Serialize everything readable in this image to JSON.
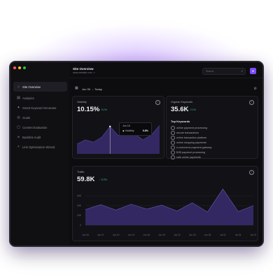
{
  "window": {
    "dot_colors": [
      "#ff5f57",
      "#febc2e",
      "#28c840"
    ]
  },
  "sidebar": {
    "items": [
      {
        "label": "Site Overview",
        "icon": "home-icon",
        "active": true
      },
      {
        "label": "Analytics",
        "icon": "analytics-icon",
        "active": false
      },
      {
        "label": "Smart Keyword Generator",
        "icon": "sparkle-icon",
        "active": false
      },
      {
        "label": "Goals",
        "icon": "target-icon",
        "active": false
      },
      {
        "label": "Content Evaluation",
        "icon": "document-icon",
        "active": false
      },
      {
        "label": "Backlink Audit",
        "icon": "link-icon",
        "active": false
      },
      {
        "label": "Link Optimization Wizard",
        "icon": "wand-icon",
        "active": false
      }
    ]
  },
  "header": {
    "title": "Site Overview",
    "url": "www.website.com",
    "search_placeholder": "Search",
    "avatar_icon": "user-icon"
  },
  "datebar": {
    "range": "Jun 30 → Today"
  },
  "visibility": {
    "label": "Visibility",
    "value": "10.15%",
    "delta": "↑ 5.1%",
    "tooltip_date": "Jun 16",
    "tooltip_label": "Visibility",
    "tooltip_value": "9.8%"
  },
  "organic_keywords": {
    "label": "Organic Keywords",
    "value": "35.6K",
    "delta": "↑ 2.1%",
    "top_title": "Top Keywords",
    "keywords": [
      "online payment processing",
      "secure transactions",
      "online transaction platform",
      "online shopping payments",
      "e-commerce payment gateway",
      "B2B payment processing",
      "safe online payments"
    ]
  },
  "traffic": {
    "label": "Traffic",
    "value": "59.8K",
    "delta": "↑ 5.2%"
  },
  "chart_data": [
    {
      "type": "area",
      "title": "",
      "series": [
        {
          "values": [
            3.5,
            5.0,
            4.2,
            6.0,
            9.8,
            6.5,
            8.2,
            7.1,
            5.0,
            6.8,
            10.15
          ]
        }
      ]
    },
    {
      "type": "area",
      "title": "",
      "categories": [
        "Jun 04",
        "Jun 07",
        "Jun 10",
        "Jun 13",
        "Jun 16",
        "Jun 19",
        "Jun 22",
        "Jun 25",
        "Jun 28",
        "Jul 01",
        "Jul 04",
        "Jul 07"
      ],
      "yticks": [
        "60K",
        "40K",
        "20K",
        "0"
      ],
      "ylim": [
        0,
        80000
      ],
      "series": [
        {
          "values": [
            32000,
            42000,
            31000,
            43000,
            33000,
            41000,
            29000,
            46000,
            27000,
            74000,
            28000,
            40000
          ]
        }
      ]
    }
  ],
  "colors": {
    "accent": "#7c4dff",
    "positive": "#3fbf82",
    "fill": "#3a2d6e"
  }
}
